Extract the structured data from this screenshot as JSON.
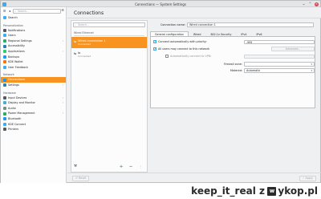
{
  "window": {
    "title": "Connections — System Settings",
    "controls": [
      "⌄",
      "⌃",
      "✕"
    ]
  },
  "sidebar": {
    "search_placeholder": "Search...",
    "top_buttons": [
      "☰",
      "◂"
    ],
    "menu_glyph": "≡",
    "items": [
      {
        "type": "item",
        "label": "Search",
        "icon_color": "#3daee9"
      },
      {
        "type": "category",
        "label": "Personalization"
      },
      {
        "type": "item",
        "label": "Notifications",
        "icon_color": "#555b61"
      },
      {
        "type": "item",
        "label": "Users",
        "icon_color": "#3daee9"
      },
      {
        "type": "item",
        "label": "Regional Settings",
        "icon_color": "#27ae60",
        "chevron": true
      },
      {
        "type": "item",
        "label": "Accessibility",
        "icon_color": "#2980b9"
      },
      {
        "type": "item",
        "label": "Applications",
        "icon_color": "#2ecc71",
        "chevron": true
      },
      {
        "type": "item",
        "label": "Backups",
        "icon_color": "#1d99f3"
      },
      {
        "type": "item",
        "label": "KDE Wallet",
        "icon_color": "#f67400"
      },
      {
        "type": "item",
        "label": "User Feedback",
        "icon_color": "#3daee9"
      },
      {
        "type": "category",
        "label": "Network"
      },
      {
        "type": "item",
        "label": "Connections",
        "icon_color": "#1d99f3",
        "active": true
      },
      {
        "type": "item",
        "label": "Settings",
        "icon_color": "#2980b9",
        "chevron": true
      },
      {
        "type": "category",
        "label": "Hardware"
      },
      {
        "type": "item",
        "label": "Input Devices",
        "icon_color": "#555b61",
        "chevron": true
      },
      {
        "type": "item",
        "label": "Display and Monitor",
        "icon_color": "#3daee9",
        "chevron": true
      },
      {
        "type": "item",
        "label": "Audio",
        "icon_color": "#7f8c8d"
      },
      {
        "type": "item",
        "label": "Power Management",
        "icon_color": "#27ae60",
        "chevron": true
      },
      {
        "type": "item",
        "label": "Bluetooth",
        "icon_color": "#1d99f3"
      },
      {
        "type": "item",
        "label": "KDE Connect",
        "icon_color": "#3daee9"
      },
      {
        "type": "item",
        "label": "Printers",
        "icon_color": "#555b61"
      }
    ]
  },
  "main": {
    "header": "Connections",
    "search_placeholder": "Search...",
    "group_label": "Wired Ethernet",
    "connections": [
      {
        "name": "Wired connection 1",
        "status": "Connected",
        "selected": true,
        "icon": "⇆"
      },
      {
        "name": "lo",
        "status": "Connected",
        "selected": false,
        "icon": "⇆"
      }
    ],
    "bottom": {
      "tool": "⚒",
      "add": "+",
      "remove": "−",
      "more": "⋮"
    }
  },
  "editor": {
    "name_label": "Connection name:",
    "name_value": "Wired connection 1",
    "tabs": [
      "General configuration",
      "Wired",
      "802.1x Security",
      "IPv4",
      "IPv6"
    ],
    "active_tab": 0,
    "options": [
      {
        "label": "Connect automatically with priority:",
        "checked": true,
        "value": "-999",
        "field": true
      },
      {
        "label": "All users may connect to this network",
        "checked": true,
        "button": "Advanced...",
        "field": false
      },
      {
        "label": "Automatically connect to VPN:",
        "checked": false,
        "field": false,
        "dim": true
      }
    ],
    "firewall_label": "Firewall zone:",
    "metered_label": "Metered:",
    "metered_value": "Automatic"
  },
  "footer": {
    "reset": "Reset",
    "apply": "Apply"
  },
  "watermark": {
    "user": "keep_it_real",
    "site_letter": "z",
    "site_box": "w",
    "site": "ykop.pl"
  }
}
